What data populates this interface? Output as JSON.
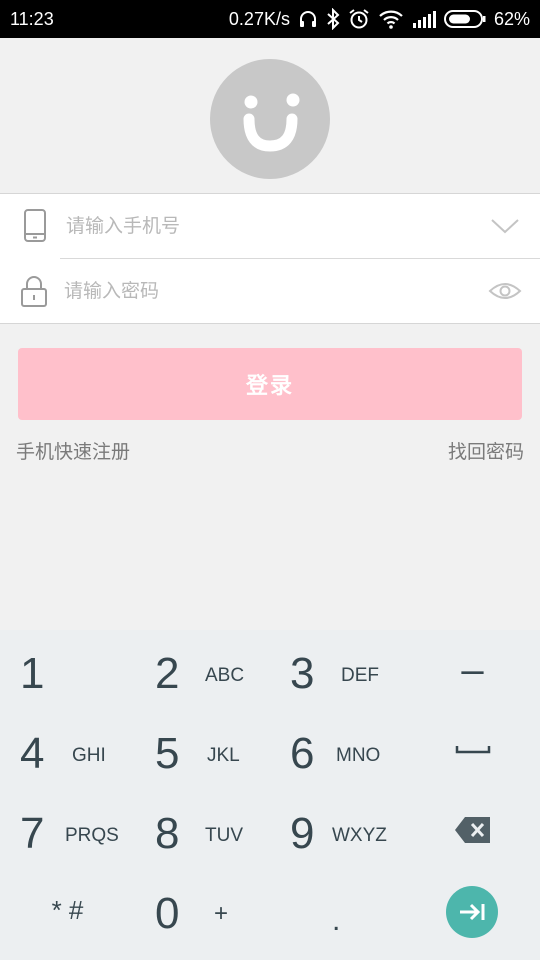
{
  "status_bar": {
    "time": "11:23",
    "network_speed": "0.27K/s",
    "battery": "62%",
    "icons": [
      "headphones-icon",
      "bluetooth-icon",
      "alarm-icon",
      "wifi-icon",
      "signal-icon",
      "battery-icon"
    ]
  },
  "avatar": {
    "icon": "smiley-face-icon",
    "color": "#c8c8c8"
  },
  "form": {
    "phone_placeholder": "请输入手机号",
    "password_placeholder": "请输入密码",
    "phone_icon": "phone-icon",
    "password_icon": "lock-icon",
    "dropdown_icon": "chevron-down-icon",
    "visibility_icon": "eye-icon"
  },
  "login_button": {
    "label": "登录",
    "color": "#ffc0cb"
  },
  "links": {
    "register": "手机快速注册",
    "forgot_password": "找回密码"
  },
  "keypad": {
    "keys": [
      {
        "digit": "1",
        "letters": ""
      },
      {
        "digit": "2",
        "letters": "ABC"
      },
      {
        "digit": "3",
        "letters": "DEF"
      },
      {
        "digit": "4",
        "letters": "GHI"
      },
      {
        "digit": "5",
        "letters": "JKL"
      },
      {
        "digit": "6",
        "letters": "MNO"
      },
      {
        "digit": "7",
        "letters": "PRQS"
      },
      {
        "digit": "8",
        "letters": "TUV"
      },
      {
        "digit": "9",
        "letters": "WXYZ"
      },
      {
        "digit": "0",
        "letters": "+"
      }
    ],
    "star_hash": "* #",
    "minus": "–",
    "dot": ".",
    "space_icon": "space-icon",
    "backspace_icon": "backspace-icon",
    "enter_icon": "enter-next-icon",
    "enter_color": "#4db6ac"
  }
}
